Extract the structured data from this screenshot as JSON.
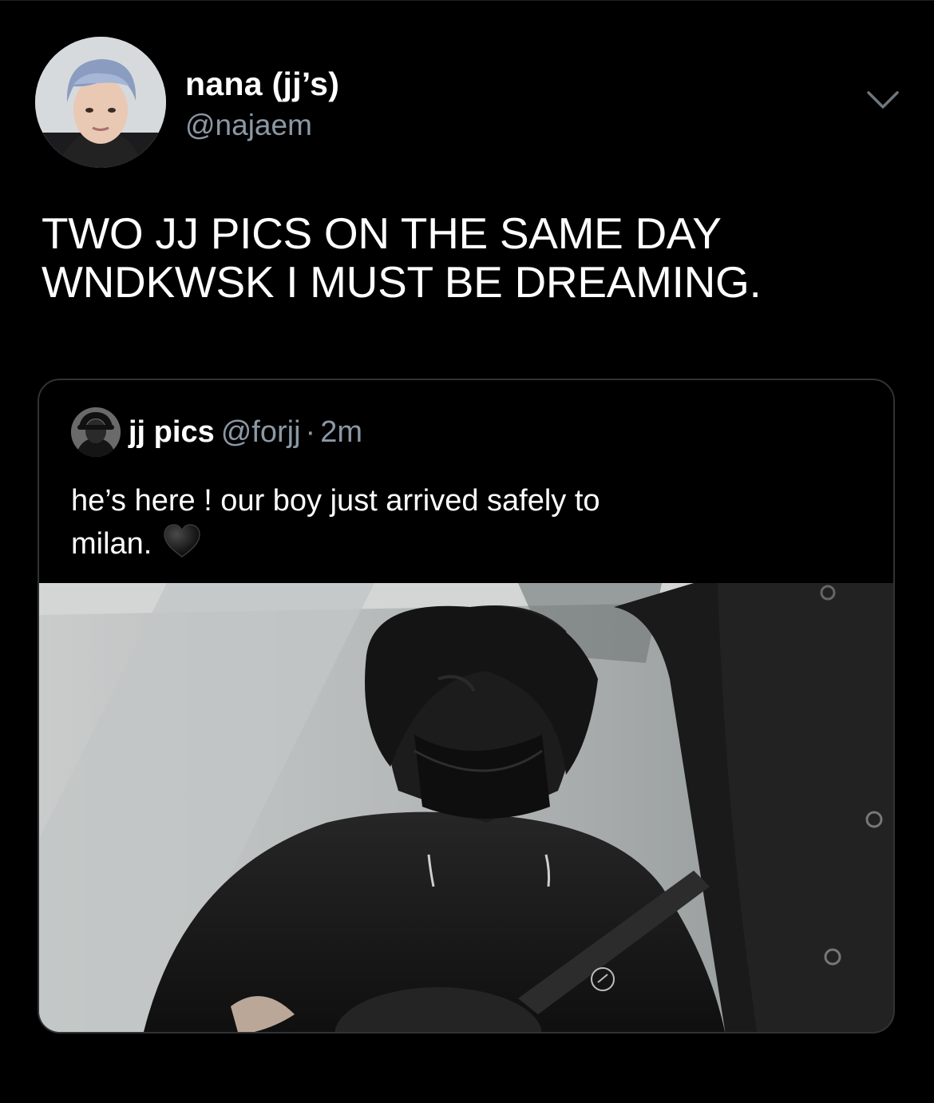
{
  "tweet": {
    "author": {
      "display_name": "nana (jj’s)",
      "handle": "@najaem",
      "avatar_icon": "profile-photo"
    },
    "menu_icon": "chevron-down-icon",
    "text_lines": [
      "TWO JJ PICS ON THE SAME DAY",
      "WNDKWSK I MUST BE DREAMING."
    ]
  },
  "quoted_tweet": {
    "author": {
      "display_name": "jj pics",
      "handle": "@forjj",
      "avatar_icon": "profile-photo"
    },
    "separator": "·",
    "time": "2m",
    "text_lines": [
      "he’s here ! our boy just arrived safely to",
      "milan."
    ],
    "emoji": "black-heart-icon",
    "media": "photo"
  },
  "colors": {
    "background": "#000000",
    "text_primary": "#ffffff",
    "text_secondary": "#8b98a5",
    "border": "#2f3336"
  }
}
